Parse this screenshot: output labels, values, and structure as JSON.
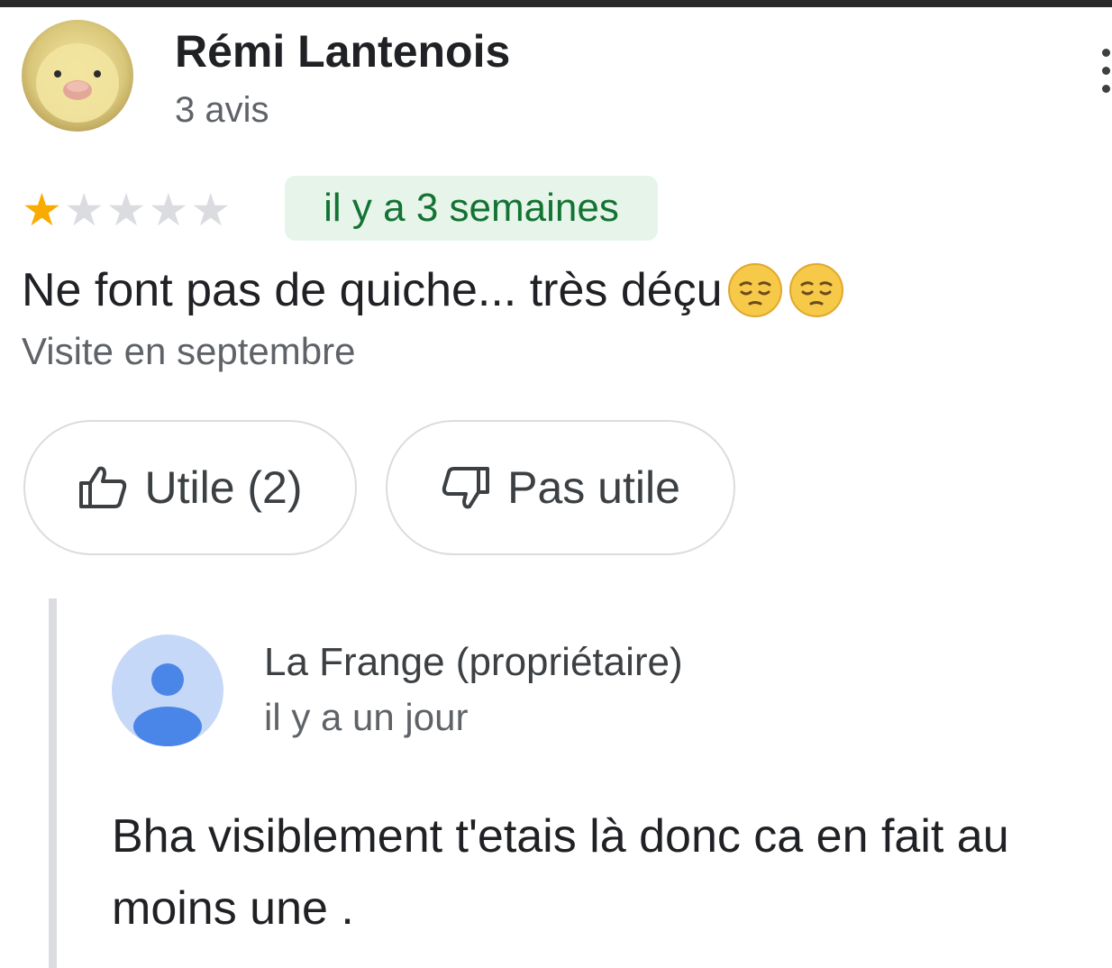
{
  "review": {
    "reviewer_name": "Rémi Lantenois",
    "reviewer_count": "3 avis",
    "rating": 1,
    "max_rating": 5,
    "date": "il y a 3 semaines",
    "text": "Ne font pas de quiche... très déçu",
    "emojis": [
      "pensive-face",
      "pensive-face"
    ],
    "visit": "Visite en septembre"
  },
  "actions": {
    "helpful_label": "Utile (2)",
    "not_helpful_label": "Pas utile"
  },
  "owner_reply": {
    "name": "La Frange (propriétaire)",
    "date": "il y a un jour",
    "text": "Bha visiblement t'etais là donc ca en fait au moins une ."
  },
  "icons": {
    "more": "more-vertical-icon",
    "thumbs_up": "thumbs-up-icon",
    "thumbs_down": "thumbs-down-icon",
    "owner_avatar": "person-icon"
  },
  "colors": {
    "star_filled": "#f9ab00",
    "star_empty": "#dadce0",
    "date_chip_bg": "#e6f4ea",
    "date_chip_text": "#137333",
    "owner_avatar_bg": "#c6d8f7",
    "owner_avatar_fg": "#4a86e8"
  }
}
